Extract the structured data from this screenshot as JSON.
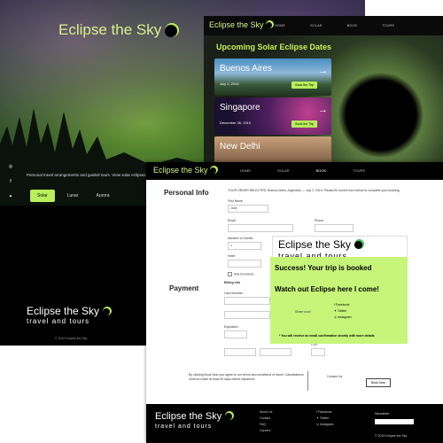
{
  "home": {
    "brand": "Eclipse the Sky",
    "tagline": "Personal travel arrangements and guided tours. View solar eclipses and more. Discover your dream trip today!",
    "social": [
      "instagram-icon",
      "facebook-icon",
      "twitter-icon"
    ],
    "btn_solar": "Solar",
    "btn_lunar": "Lunar",
    "btn_aurora": "Aurora",
    "footer_brand": "Eclipse the Sky",
    "footer_sub": "travel and tours",
    "copyright": "© 2019 Eclipse the Sky"
  },
  "dates": {
    "brand": "Eclipse the Sky",
    "nav": [
      "HOME",
      "SOLAR",
      "BOOK",
      "TOURS"
    ],
    "heading": "Upcoming Solar Eclipse Dates",
    "cards": [
      {
        "city": "Buenos Aires",
        "date": "July 2, 2019",
        "cta": "Book the Trip"
      },
      {
        "city": "Singapore",
        "date": "December 26, 2019",
        "cta": "Book the Trip"
      },
      {
        "city": "New Delhi",
        "date": "",
        "cta": ""
      }
    ]
  },
  "booking": {
    "brand": "Eclipse the Sky",
    "nav": [
      "HOME",
      "SOLAR",
      "BOOK",
      "TOURS"
    ],
    "personal_title": "Personal Info",
    "payment_title": "Payment",
    "notice": "YOUR ORDER SELECTED: Buenos Aires, Argentina — July 2, 2019. Please fill out the form below to complete your booking.",
    "name_label": "First Name",
    "name_value": "Jane",
    "email_label": "Email",
    "phone_label": "Phone",
    "phone_value": "",
    "guests_label": "Number of Guests",
    "guests_value": "1",
    "hotel_label": "Hotel",
    "add_insurance": "Add Insurance",
    "billing_title": "Billing Info",
    "card_label": "Card Number",
    "exp_label": "Expiration",
    "cvv_label": "CVV",
    "next": "Next",
    "terms": "By clicking Book Now you agree to our terms and conditions of travel. Cancellations must be made at least 30 days before departure.",
    "contact": "Contact Us",
    "book_now": "Book Now",
    "footer_brand": "Eclipse the Sky",
    "footer_sub": "travel and tours",
    "footer_links": [
      "About Us",
      "Contact",
      "FAQ",
      "Careers"
    ],
    "footer_social": [
      "Facebook",
      "Twitter",
      "Instagram"
    ],
    "footer_sign": "Newsletter",
    "footer_copy": "© 2019 Eclipse the Sky"
  },
  "success": {
    "brand": "Eclipse the Sky",
    "sub": "travel and tours",
    "line1": "Success! Your trip is booked",
    "line2": "Watch out Eclipse here I come!",
    "share_label": "Share now!",
    "share": [
      "Facebook",
      "Twitter",
      "Instagram"
    ],
    "note": "* You will receive an email confirmation shortly with more details"
  },
  "colors": {
    "accent": "#b8ef5a",
    "success_bg": "#c6f57a",
    "brand_text": "#d7f08a"
  }
}
